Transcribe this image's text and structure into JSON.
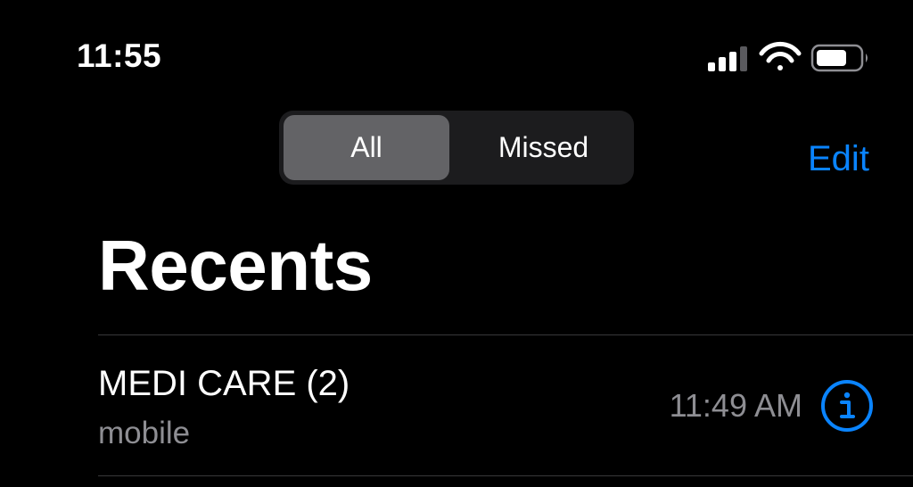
{
  "status_bar": {
    "time": "11:55",
    "icons": [
      "cellular-signal-icon",
      "wifi-icon",
      "battery-icon"
    ]
  },
  "segmented_control": {
    "options": [
      {
        "label": "All",
        "selected": true
      },
      {
        "label": "Missed",
        "selected": false
      }
    ]
  },
  "nav": {
    "edit_label": "Edit"
  },
  "page": {
    "title": "Recents"
  },
  "calls": [
    {
      "name": "MEDI CARE (2)",
      "type": "mobile",
      "time": "11:49 AM",
      "action_icon": "info-icon"
    }
  ],
  "colors": {
    "background": "#000000",
    "accent": "#0a84ff",
    "secondary_text": "#8e8e93",
    "segment_selected": "#636366",
    "segment_track": "#1c1c1e"
  }
}
